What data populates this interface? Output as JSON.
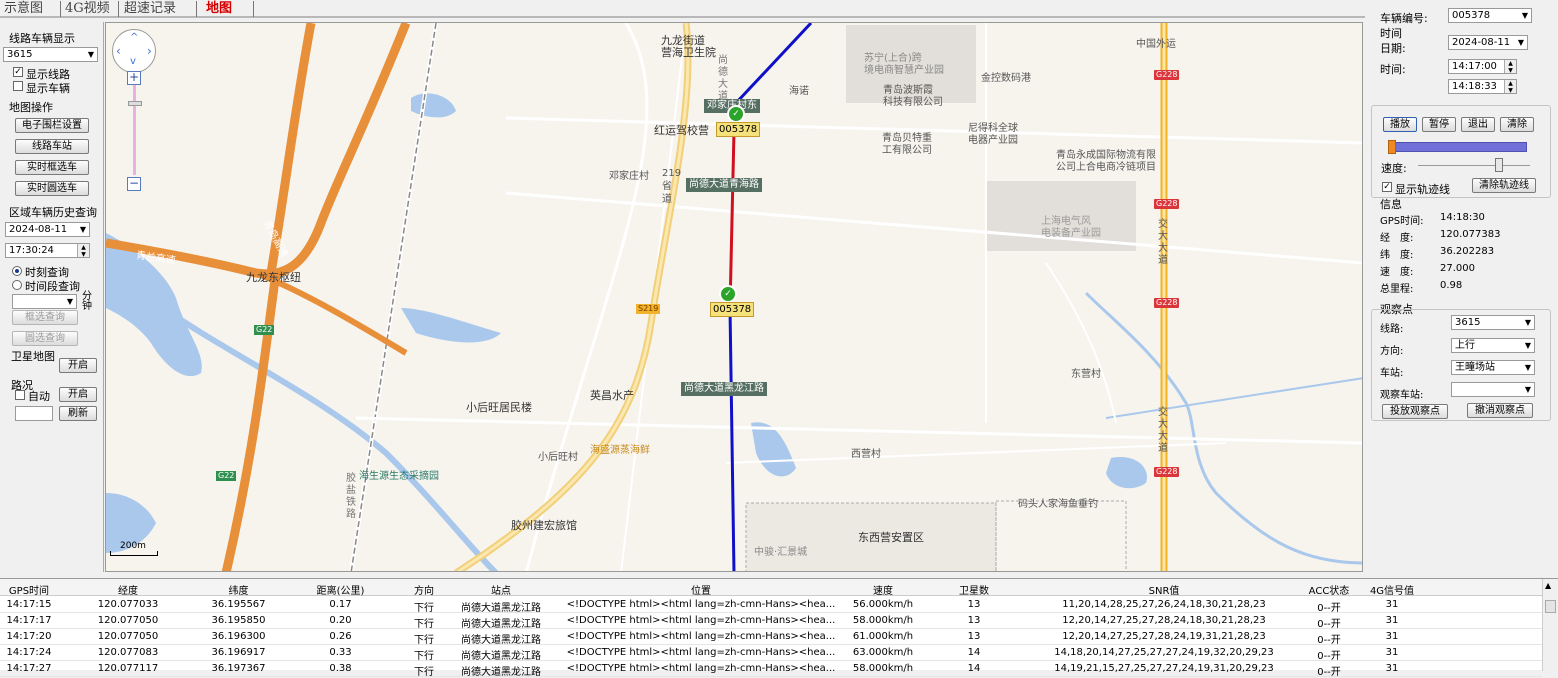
{
  "tabs": [
    "示意图",
    "4G视频",
    "超速记录",
    "地图"
  ],
  "left": {
    "route_vehicle_title": "线路车辆显示",
    "route_select": "3615",
    "show_route": "显示线路",
    "show_vehicle": "显示车辆",
    "map_ops_title": "地图操作",
    "btn_fence": "电子围栏设置",
    "btn_route_station": "线路车站",
    "btn_box_select": "实时框选车",
    "btn_circle_select": "实时圆选车",
    "area_history_title": "区域车辆历史查询",
    "date": "2024-08-11",
    "time": "17:30:24",
    "radio_moment": "时刻查询",
    "radio_period": "时间段查询",
    "minute_unit": "分钟",
    "btn_box_query": "框选查询",
    "btn_circle_query": "圆选查询",
    "satellite_title": "卫星地图",
    "btn_sat_open": "开启",
    "traffic_title": "路况",
    "auto_label": "自动",
    "btn_traffic_open": "开启",
    "btn_refresh": "刷新"
  },
  "map": {
    "scale": "200m",
    "stations": [
      "邓家庄村东",
      "尚德大道青海路",
      "尚德大道黑龙江路"
    ],
    "vehicle_id": "005378",
    "labels": {
      "jiulong": "九龙街道\n营海卫生院",
      "zhongguo": "中国外运",
      "suning": "苏宁(上合)跨\n境电商智慧产业园",
      "jinkong": "金控数码港",
      "haino": "海诺",
      "qingdao_bosi": "青岛波斯霞\n科技有限公司",
      "bei_te": "青岛贝特重\n工有限公司",
      "nide": "尼得科全球\n电器产业园",
      "yongcheng": "青岛永成国际物流有限\n公司上合电商冷链项目",
      "shanghai_elec": "上海电气风\n电装备产业园",
      "hongyun": "红运驾校营",
      "dengjiazhuang": "邓家庄村",
      "qingshang": "青岛高速",
      "qinglan": "青兰高速",
      "jiulong_hub": "九龙东枢纽",
      "s219": "219省道",
      "xiaohouwang": "小后旺居民楼",
      "yingchang": "英昌水产",
      "xiaohouwang2": "小后旺村",
      "haisheng": "海盛源蒸海鲜",
      "haishengyuan": "海生源生态采摘园",
      "jiaozhou_hotel": "胶州建宏旅馆",
      "xiying": "西营村",
      "dongxiying": "东西营安置区",
      "dongying": "东营村",
      "matou": "码头人家海鱼垂钓",
      "zhongjun": "中骏·汇景城",
      "jiaoda": "交大大道",
      "shangde": "尚德大道",
      "jiaoyanjiao": "胶盐铁路"
    },
    "shields": {
      "g228": "G228",
      "s219": "S219",
      "g22": "G22"
    }
  },
  "right": {
    "vehicle_no_label": "车辆编号:",
    "vehicle_no": "005378",
    "time_title": "时间",
    "date_label": "日期:",
    "date": "2024-08-11",
    "time_label": "时间:",
    "time_start": "14:17:00",
    "time_end": "14:18:33",
    "btn_play": "播放",
    "btn_pause": "暂停",
    "btn_exit": "退出",
    "btn_clear": "清除",
    "speed_label": "速度:",
    "show_track": "显示轨迹线",
    "btn_clear_track": "清除轨迹线",
    "info_title": "信息",
    "gps_time_label": "GPS时间:",
    "gps_time": "14:18:30",
    "lng_label": "经　度:",
    "lng": "120.077383",
    "lat_label": "纬　度:",
    "lat": "36.202283",
    "speed2_label": "速　度:",
    "speed": "27.000",
    "mileage_label": "总里程:",
    "mileage": "0.98",
    "observe_title": "观察点",
    "line_label": "线路:",
    "line": "3615",
    "dir_label": "方向:",
    "dir": "上行",
    "station_label": "车站:",
    "station": "王疃场站",
    "obs_station_label": "观察车站:",
    "obs_station": "",
    "btn_place": "投放观察点",
    "btn_cancel": "撤消观察点"
  },
  "table": {
    "headers": [
      "GPS时间",
      "经度",
      "纬度",
      "距离(公里)",
      "方向",
      "站点",
      "位置",
      "速度",
      "卫星数",
      "SNR值",
      "ACC状态",
      "4G信号值"
    ],
    "rows": [
      [
        "14:17:15",
        "120.077033",
        "36.195567",
        "0.17",
        "下行",
        "尚德大道黑龙江路",
        "<!DOCTYPE html><html lang=zh-cmn-Hans><hea...",
        "56.000km/h",
        "13",
        "11,20,14,28,25,27,26,24,18,30,21,28,23",
        "0--开",
        "31"
      ],
      [
        "14:17:17",
        "120.077050",
        "36.195850",
        "0.20",
        "下行",
        "尚德大道黑龙江路",
        "<!DOCTYPE html><html lang=zh-cmn-Hans><hea...",
        "58.000km/h",
        "13",
        "12,20,14,27,25,27,28,24,18,30,21,28,23",
        "0--开",
        "31"
      ],
      [
        "14:17:20",
        "120.077050",
        "36.196300",
        "0.26",
        "下行",
        "尚德大道黑龙江路",
        "<!DOCTYPE html><html lang=zh-cmn-Hans><hea...",
        "61.000km/h",
        "13",
        "12,20,14,27,25,27,28,24,19,31,21,28,23",
        "0--开",
        "31"
      ],
      [
        "14:17:24",
        "120.077083",
        "36.196917",
        "0.33",
        "下行",
        "尚德大道黑龙江路",
        "<!DOCTYPE html><html lang=zh-cmn-Hans><hea...",
        "63.000km/h",
        "14",
        "14,18,20,14,27,25,27,27,24,19,32,20,29,23",
        "0--开",
        "31"
      ],
      [
        "14:17:27",
        "120.077117",
        "36.197367",
        "0.38",
        "下行",
        "尚德大道黑龙江路",
        "<!DOCTYPE html><html lang=zh-cmn-Hans><hea...",
        "58.000km/h",
        "14",
        "14,19,21,15,27,25,27,27,24,19,31,20,29,23",
        "0--开",
        "31"
      ]
    ]
  }
}
